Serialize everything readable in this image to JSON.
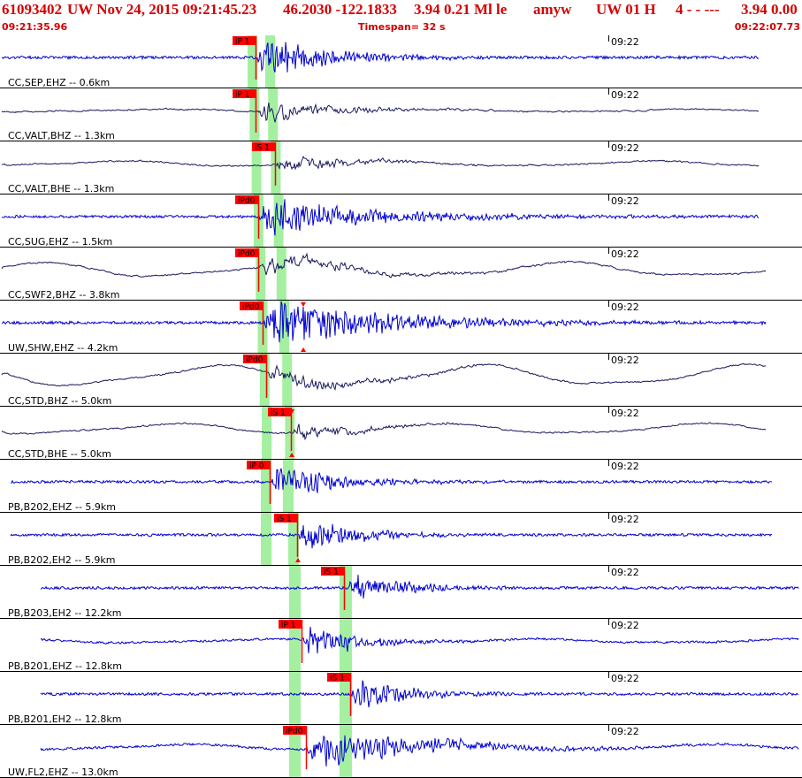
{
  "header": {
    "event_id": "61093402",
    "network_date": "UW Nov 24, 2015 09:21:45.23",
    "coordinates": "46.2030 -122.1833",
    "magnitude_info": "3.94 0.21 Ml le",
    "analyst": "amyw",
    "source_info": "UW 01 H",
    "count_info": "4 - - ---",
    "magnitude_tail": "3.94 0.00",
    "start_time": "09:21:35.96",
    "timespan": "Timespan=  32 s",
    "end_time": "09:22:07.73"
  },
  "colors": {
    "header_text": "#d40000",
    "pick_flag": "#ff0000",
    "pick_band": "#a4f0a0",
    "trace_blue": "#0000d0",
    "trace_dark": "#1a1a5e",
    "panel_border": "#000000"
  },
  "traces": [
    {
      "label": "CC,SEP,EHZ -- 0.6km",
      "time_tick": "09:22",
      "color": "blue",
      "picks": [
        {
          "label": "iP 1"
        }
      ]
    },
    {
      "label": "CC,VALT,BHZ -- 1.3km",
      "time_tick": "09:22",
      "color": "dark",
      "picks": [
        {
          "label": "iP 1"
        }
      ]
    },
    {
      "label": "CC,VALT,BHE -- 1.3km",
      "time_tick": "09:22",
      "color": "dark",
      "picks": [
        {
          "label": "iS 1"
        }
      ]
    },
    {
      "label": "CC,SUG,EHZ -- 1.5km",
      "time_tick": "09:22",
      "color": "blue",
      "picks": [
        {
          "label": "iPd0"
        }
      ]
    },
    {
      "label": "CC,SWF2,BHZ -- 3.8km",
      "time_tick": "09:22",
      "color": "dark",
      "picks": [
        {
          "label": "iPd0"
        }
      ]
    },
    {
      "label": "UW,SHW,EHZ -- 4.2km",
      "time_tick": "09:22",
      "color": "blue",
      "picks": [
        {
          "label": "iPd0"
        }
      ]
    },
    {
      "label": "CC,STD,BHZ -- 5.0km",
      "time_tick": "09:22",
      "color": "dark",
      "picks": [
        {
          "label": "iPd0"
        }
      ]
    },
    {
      "label": "CC,STD,BHE -- 5.0km",
      "time_tick": "09:22",
      "color": "dark",
      "picks": [
        {
          "label": "iS 1"
        }
      ]
    },
    {
      "label": "PB,B202,EHZ -- 5.9km",
      "time_tick": "09:22",
      "color": "blue",
      "picks": [
        {
          "label": "iP 0"
        }
      ]
    },
    {
      "label": "PB,B202,EH2 -- 5.9km",
      "time_tick": "09:22",
      "color": "blue",
      "picks": [
        {
          "label": "iS 1"
        }
      ]
    },
    {
      "label": "PB,B203,EH2 -- 12.2km",
      "time_tick": "09:22",
      "color": "blue",
      "picks": [
        {
          "label": "iS 1"
        }
      ]
    },
    {
      "label": "PB,B201,EHZ -- 12.8km",
      "time_tick": "09:22",
      "color": "blue",
      "picks": [
        {
          "label": "iP 1"
        }
      ]
    },
    {
      "label": "PB,B201,EH2 -- 12.8km",
      "time_tick": "09:22",
      "color": "blue",
      "picks": [
        {
          "label": "iS 1"
        }
      ]
    },
    {
      "label": "UW,FL2,EHZ -- 13.0km",
      "time_tick": "09:22",
      "color": "blue",
      "picks": [
        {
          "label": "iPd0"
        }
      ]
    }
  ]
}
